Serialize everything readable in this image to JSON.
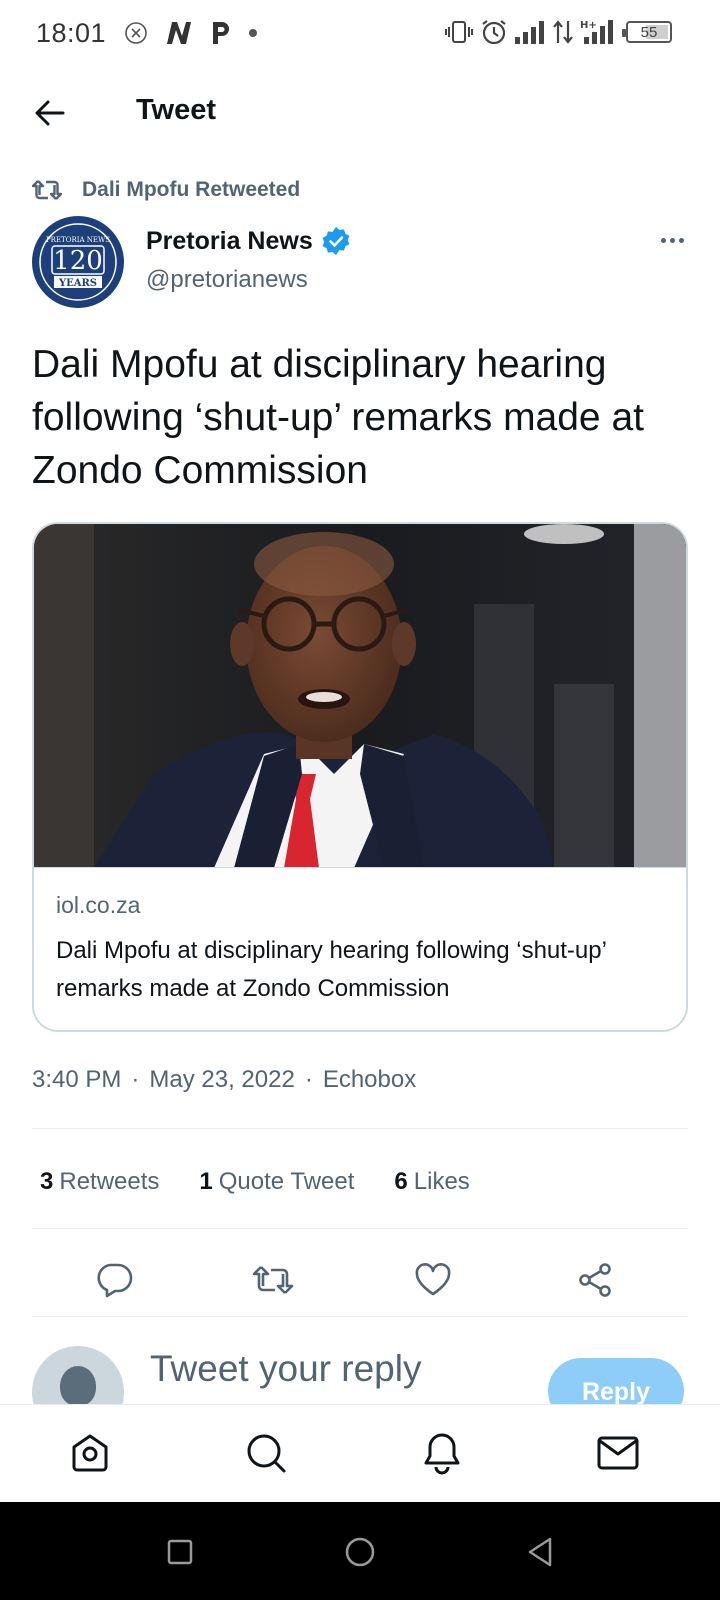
{
  "status_bar": {
    "time": "18:01",
    "network_type": "H+",
    "battery": "55"
  },
  "header": {
    "title": "Tweet"
  },
  "retweet_note": "Dali Mpofu Retweeted",
  "author": {
    "name": "Pretoria News",
    "handle": "@pretorianews",
    "verified": true,
    "avatar_logo": "120 YEARS",
    "avatar_logo_top": "Pretoria News"
  },
  "tweet": {
    "text": "Dali Mpofu at disciplinary hearing following ‘shut-up’ remarks made at Zondo Commission",
    "card": {
      "domain": "iol.co.za",
      "title": "Dali Mpofu at disciplinary hearing following ‘shut-up’ remarks made at Zondo Commission"
    },
    "time": "3:40 PM",
    "date": "May 23, 2022",
    "source": "Echobox",
    "separator": "·"
  },
  "stats": {
    "retweets_count": "3",
    "retweets_label": "Retweets",
    "quotes_count": "1",
    "quotes_label": "Quote Tweet",
    "likes_count": "6",
    "likes_label": "Likes"
  },
  "reply": {
    "placeholder": "Tweet your reply",
    "button": "Reply"
  },
  "colors": {
    "accent": "#1d9bf0",
    "reply_button_disabled": "#8ecdf8",
    "secondary_text": "#536471",
    "verified": "#1d9bf0"
  },
  "icons": {
    "back": "arrow-left-icon",
    "retweet": "retweet-icon",
    "verified": "verified-badge-icon",
    "more": "more-horizontal-icon",
    "reply": "comment-icon",
    "like": "heart-icon",
    "share": "share-icon",
    "nav_home": "home-icon",
    "nav_search": "search-icon",
    "nav_notifications": "bell-icon",
    "nav_messages": "mail-icon"
  }
}
